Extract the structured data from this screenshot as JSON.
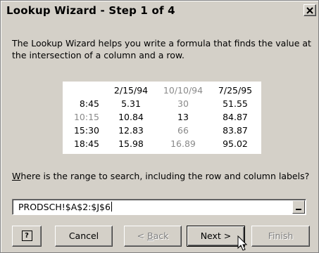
{
  "window": {
    "title": "Lookup Wizard - Step 1 of 4",
    "close_icon": "close-icon"
  },
  "description": "The Lookup Wizard helps you write a formula that finds the value at the intersection of a column and a row.",
  "preview": {
    "columns": [
      "2/15/94",
      "10/10/94",
      "7/25/95"
    ],
    "rows": [
      {
        "label": "8:45",
        "values": [
          "5.31",
          "30",
          "51.55"
        ]
      },
      {
        "label": "10:15",
        "values": [
          "10.84",
          "13",
          "84.87"
        ]
      },
      {
        "label": "15:30",
        "values": [
          "12.83",
          "66",
          "83.87"
        ]
      },
      {
        "label": "18:45",
        "values": [
          "15.98",
          "16.89",
          "95.02"
        ]
      }
    ]
  },
  "question": {
    "accel": "W",
    "rest": "here is the range to search, including the row and column labels?"
  },
  "range_input": {
    "value": "PRODSCH!$A$2:$J$6"
  },
  "buttons": {
    "help": "?",
    "cancel": "Cancel",
    "back_prefix": "< ",
    "back_accel": "B",
    "back_rest": "ack",
    "next": "Next >",
    "finish": "Finish"
  },
  "colors": {
    "dialog_bg": "#d4d0c8",
    "dim_text": "#8a8a8a",
    "disabled_text": "#808080"
  }
}
